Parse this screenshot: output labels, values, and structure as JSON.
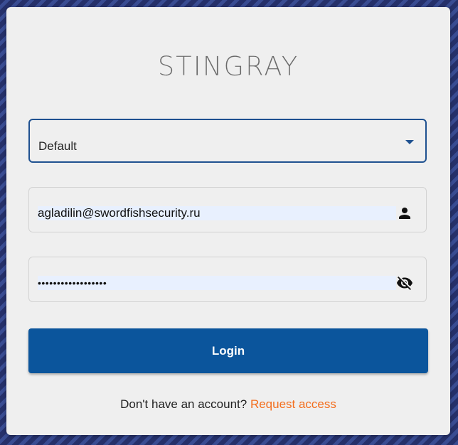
{
  "app": {
    "logo_text": "STINGRAY"
  },
  "colors": {
    "primary": "#0b559c",
    "link": "#f36e1e",
    "card": "#efefef",
    "autofill": "#e8f0fe"
  },
  "form": {
    "select": {
      "value": "Default",
      "icon": "caret-down-icon"
    },
    "email": {
      "value": "agladilin@swordfishsecurity.ru",
      "icon": "person-icon"
    },
    "password": {
      "value": "••••••••••••••••••",
      "icon": "eye-off-icon"
    },
    "login_label": "Login"
  },
  "footer": {
    "prompt": "Don't have an account? ",
    "link_label": "Request access"
  }
}
